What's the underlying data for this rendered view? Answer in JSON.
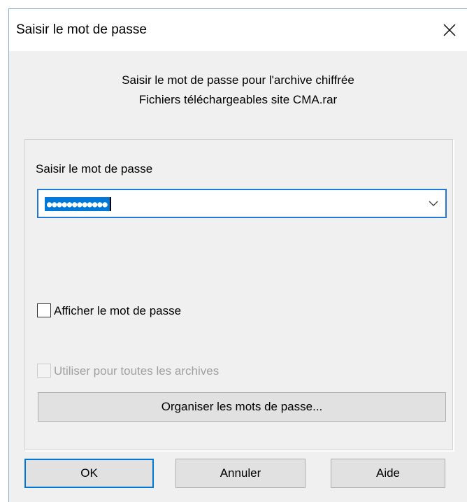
{
  "window": {
    "title": "Saisir le mot de passe"
  },
  "prompt": {
    "line1": "Saisir le mot de passe pour l'archive chiffrée",
    "line2": "Fichiers téléchargeables site CMA.rar"
  },
  "password_section": {
    "label": "Saisir le mot de passe",
    "value_masked": "●●●●●●●●●●●●"
  },
  "show_password": {
    "label": "Afficher le mot de passe",
    "checked": false
  },
  "use_for_all": {
    "label": "Utiliser pour toutes les archives",
    "checked": false,
    "enabled": false
  },
  "organize_button": {
    "label": "Organiser les mots de passe..."
  },
  "buttons": {
    "ok": "OK",
    "cancel": "Annuler",
    "help": "Aide"
  },
  "colors": {
    "accent": "#0078d7",
    "dialog_bg": "#f0f0f0",
    "button_bg": "#e1e1e1"
  },
  "icons": {
    "close": "close-icon",
    "dropdown": "chevron-down-icon"
  }
}
